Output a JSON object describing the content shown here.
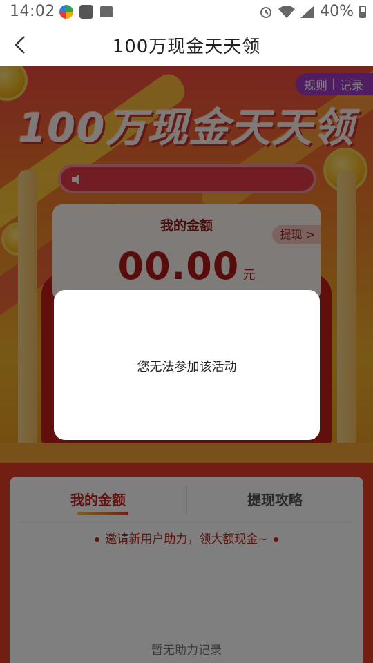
{
  "status_bar": {
    "time": "14:02",
    "battery": "40%"
  },
  "nav": {
    "title": "100万现金天天领"
  },
  "hero": {
    "banner_title": "100万现金天天领",
    "rules_label": "规则",
    "records_label": "记录",
    "amount_label": "我的金额",
    "withdraw_label": "提现 >",
    "amount_value": "00.00",
    "amount_unit": "元"
  },
  "panel": {
    "tabs": [
      {
        "label": "我的金额",
        "active": true
      },
      {
        "label": "提现攻略",
        "active": false
      }
    ],
    "invite_text": "邀请新用户助力，领大额现金~",
    "empty_text": "暂无助力记录"
  },
  "modal": {
    "message": "您无法参加该活动"
  },
  "colors": {
    "accent": "#c0261e",
    "rules_bg": "#a33ac4",
    "overlay": "rgba(0,0,0,0.5)"
  }
}
